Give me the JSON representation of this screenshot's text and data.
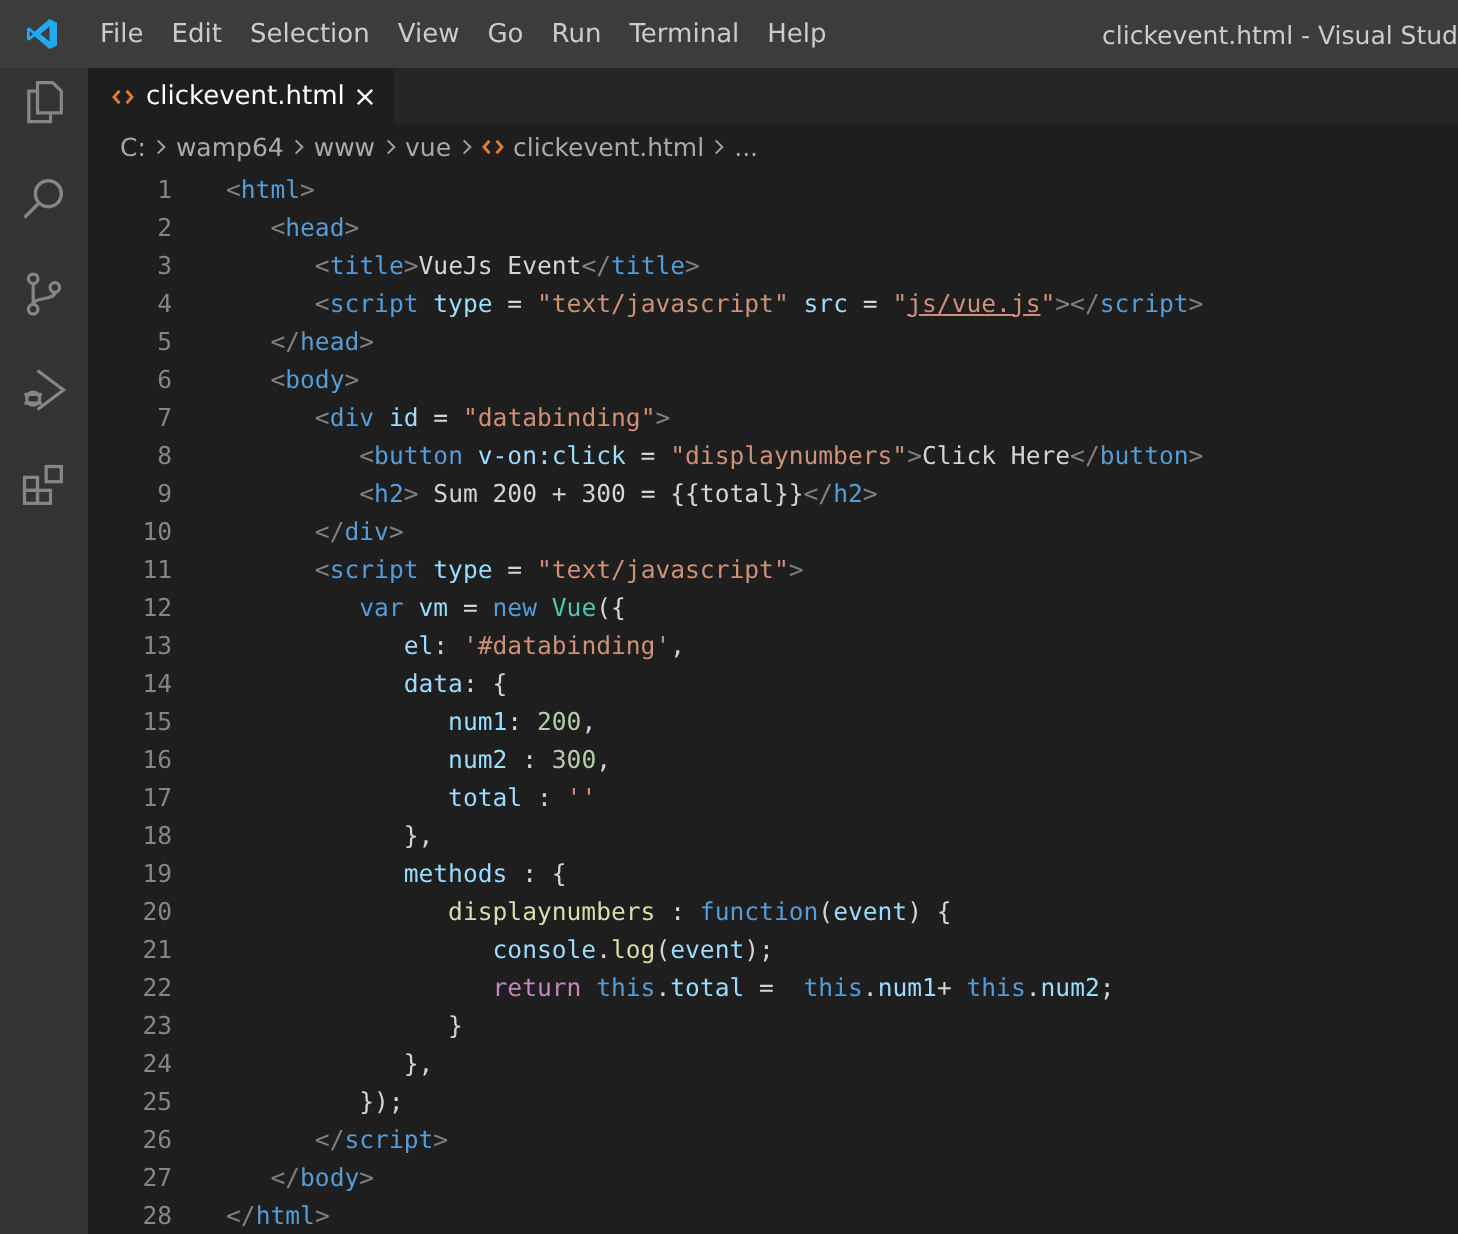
{
  "menu": [
    "File",
    "Edit",
    "Selection",
    "View",
    "Go",
    "Run",
    "Terminal",
    "Help"
  ],
  "window": {
    "title": "clickevent.html - Visual Stud"
  },
  "activity_bar": [
    {
      "kind": "files"
    },
    {
      "kind": "search"
    },
    {
      "kind": "source-control"
    },
    {
      "kind": "debug"
    },
    {
      "kind": "extensions"
    }
  ],
  "tabs": [
    {
      "label": "clickevent.html",
      "selected": true
    }
  ],
  "breadcrumbs": [
    {
      "kind": "folder",
      "text": "C:"
    },
    {
      "kind": "folder",
      "text": "wamp64"
    },
    {
      "kind": "folder",
      "text": "www"
    },
    {
      "kind": "folder",
      "text": "vue"
    },
    {
      "kind": "file",
      "text": "clickevent.html"
    },
    {
      "kind": "folder",
      "text": "..."
    }
  ],
  "lines": [
    {
      "number": "1",
      "tokens": [
        {
          "kind": "punct",
          "text": "<"
        },
        {
          "kind": "tag",
          "text": "html"
        },
        {
          "kind": "punct",
          "text": ">"
        }
      ]
    },
    {
      "number": "2",
      "tokens": [
        {
          "kind": "punct",
          "text": "   <"
        },
        {
          "kind": "tag",
          "text": "head"
        },
        {
          "kind": "punct",
          "text": ">"
        }
      ]
    },
    {
      "number": "3",
      "tokens": [
        {
          "kind": "punct",
          "text": "      <"
        },
        {
          "kind": "tag",
          "text": "title"
        },
        {
          "kind": "punct",
          "text": ">"
        },
        {
          "kind": "text",
          "text": "VueJs Event"
        },
        {
          "kind": "punct",
          "text": "</"
        },
        {
          "kind": "tag",
          "text": "title"
        },
        {
          "kind": "punct",
          "text": ">"
        }
      ]
    },
    {
      "number": "4",
      "tokens": [
        {
          "kind": "punct",
          "text": "      <"
        },
        {
          "kind": "tag",
          "text": "script"
        },
        {
          "kind": "attr",
          "text": " type"
        },
        {
          "kind": "text",
          "text": " = "
        },
        {
          "kind": "str",
          "text": "\"text/javascript\""
        },
        {
          "kind": "attr",
          "text": " src"
        },
        {
          "kind": "text",
          "text": " = "
        },
        {
          "kind": "str",
          "text": "\""
        },
        {
          "kind": "link",
          "text": "js/vue.js"
        },
        {
          "kind": "str",
          "text": "\""
        },
        {
          "kind": "punct",
          "text": "></"
        },
        {
          "kind": "tag",
          "text": "script"
        },
        {
          "kind": "punct",
          "text": ">"
        }
      ]
    },
    {
      "number": "5",
      "tokens": [
        {
          "kind": "punct",
          "text": "   </"
        },
        {
          "kind": "tag",
          "text": "head"
        },
        {
          "kind": "punct",
          "text": ">"
        }
      ]
    },
    {
      "number": "6",
      "tokens": [
        {
          "kind": "punct",
          "text": "   <"
        },
        {
          "kind": "tag",
          "text": "body"
        },
        {
          "kind": "punct",
          "text": ">"
        }
      ]
    },
    {
      "number": "7",
      "tokens": [
        {
          "kind": "punct",
          "text": "      <"
        },
        {
          "kind": "tag",
          "text": "div"
        },
        {
          "kind": "attr",
          "text": " id"
        },
        {
          "kind": "text",
          "text": " = "
        },
        {
          "kind": "str",
          "text": "\"databinding\""
        },
        {
          "kind": "punct",
          "text": ">"
        }
      ]
    },
    {
      "number": "8",
      "tokens": [
        {
          "kind": "punct",
          "text": "         <"
        },
        {
          "kind": "tag",
          "text": "button"
        },
        {
          "kind": "attr",
          "text": " v-on:click"
        },
        {
          "kind": "text",
          "text": " = "
        },
        {
          "kind": "str",
          "text": "\"displaynumbers\""
        },
        {
          "kind": "punct",
          "text": ">"
        },
        {
          "kind": "text",
          "text": "Click Here"
        },
        {
          "kind": "punct",
          "text": "</"
        },
        {
          "kind": "tag",
          "text": "button"
        },
        {
          "kind": "punct",
          "text": ">"
        }
      ]
    },
    {
      "number": "9",
      "tokens": [
        {
          "kind": "punct",
          "text": "         <"
        },
        {
          "kind": "tag",
          "text": "h2"
        },
        {
          "kind": "punct",
          "text": ">"
        },
        {
          "kind": "text",
          "text": " Sum 200 + 300 = {{total}}"
        },
        {
          "kind": "punct",
          "text": "</"
        },
        {
          "kind": "tag",
          "text": "h2"
        },
        {
          "kind": "punct",
          "text": ">"
        }
      ]
    },
    {
      "number": "10",
      "tokens": [
        {
          "kind": "punct",
          "text": "      </"
        },
        {
          "kind": "tag",
          "text": "div"
        },
        {
          "kind": "punct",
          "text": ">"
        }
      ]
    },
    {
      "number": "11",
      "tokens": [
        {
          "kind": "punct",
          "text": "      <"
        },
        {
          "kind": "tag",
          "text": "script"
        },
        {
          "kind": "attr",
          "text": " type"
        },
        {
          "kind": "text",
          "text": " = "
        },
        {
          "kind": "str",
          "text": "\"text/javascript\""
        },
        {
          "kind": "punct",
          "text": ">"
        }
      ]
    },
    {
      "number": "12",
      "tokens": [
        {
          "kind": "kw",
          "text": "         var"
        },
        {
          "kind": "var",
          "text": " vm"
        },
        {
          "kind": "text",
          "text": " = "
        },
        {
          "kind": "kw",
          "text": "new"
        },
        {
          "kind": "cls",
          "text": " Vue"
        },
        {
          "kind": "text",
          "text": "({"
        }
      ]
    },
    {
      "number": "13",
      "tokens": [
        {
          "kind": "var",
          "text": "            el"
        },
        {
          "kind": "text",
          "text": ": "
        },
        {
          "kind": "str",
          "text": "'#databinding'"
        },
        {
          "kind": "text",
          "text": ","
        }
      ]
    },
    {
      "number": "14",
      "tokens": [
        {
          "kind": "var",
          "text": "            data"
        },
        {
          "kind": "text",
          "text": ": {"
        }
      ]
    },
    {
      "number": "15",
      "tokens": [
        {
          "kind": "var",
          "text": "               num1"
        },
        {
          "kind": "text",
          "text": ": "
        },
        {
          "kind": "num",
          "text": "200"
        },
        {
          "kind": "text",
          "text": ","
        }
      ]
    },
    {
      "number": "16",
      "tokens": [
        {
          "kind": "var",
          "text": "               num2"
        },
        {
          "kind": "text",
          "text": " : "
        },
        {
          "kind": "num",
          "text": "300"
        },
        {
          "kind": "text",
          "text": ","
        }
      ]
    },
    {
      "number": "17",
      "tokens": [
        {
          "kind": "var",
          "text": "               total"
        },
        {
          "kind": "text",
          "text": " : "
        },
        {
          "kind": "str",
          "text": "''"
        }
      ]
    },
    {
      "number": "18",
      "tokens": [
        {
          "kind": "text",
          "text": "            },"
        }
      ]
    },
    {
      "number": "19",
      "tokens": [
        {
          "kind": "var",
          "text": "            methods"
        },
        {
          "kind": "text",
          "text": " : {"
        }
      ]
    },
    {
      "number": "20",
      "tokens": [
        {
          "kind": "fn",
          "text": "               displaynumbers"
        },
        {
          "kind": "text",
          "text": " : "
        },
        {
          "kind": "kw",
          "text": "function"
        },
        {
          "kind": "text",
          "text": "("
        },
        {
          "kind": "var",
          "text": "event"
        },
        {
          "kind": "text",
          "text": ") {"
        }
      ]
    },
    {
      "number": "21",
      "tokens": [
        {
          "kind": "var",
          "text": "                  console"
        },
        {
          "kind": "text",
          "text": "."
        },
        {
          "kind": "fn",
          "text": "log"
        },
        {
          "kind": "text",
          "text": "("
        },
        {
          "kind": "var",
          "text": "event"
        },
        {
          "kind": "text",
          "text": ");"
        }
      ]
    },
    {
      "number": "22",
      "tokens": [
        {
          "kind": "ctl",
          "text": "                  return"
        },
        {
          "kind": "kw",
          "text": " this"
        },
        {
          "kind": "text",
          "text": "."
        },
        {
          "kind": "var",
          "text": "total"
        },
        {
          "kind": "text",
          "text": " =  "
        },
        {
          "kind": "kw",
          "text": "this"
        },
        {
          "kind": "text",
          "text": "."
        },
        {
          "kind": "var",
          "text": "num1"
        },
        {
          "kind": "text",
          "text": "+ "
        },
        {
          "kind": "kw",
          "text": "this"
        },
        {
          "kind": "text",
          "text": "."
        },
        {
          "kind": "var",
          "text": "num2"
        },
        {
          "kind": "text",
          "text": ";"
        }
      ]
    },
    {
      "number": "23",
      "tokens": [
        {
          "kind": "text",
          "text": "               }"
        }
      ]
    },
    {
      "number": "24",
      "tokens": [
        {
          "kind": "text",
          "text": "            },"
        }
      ]
    },
    {
      "number": "25",
      "tokens": [
        {
          "kind": "text",
          "text": "         });"
        }
      ]
    },
    {
      "number": "26",
      "tokens": [
        {
          "kind": "punct",
          "text": "      </"
        },
        {
          "kind": "tag",
          "text": "script"
        },
        {
          "kind": "punct",
          "text": ">"
        }
      ]
    },
    {
      "number": "27",
      "tokens": [
        {
          "kind": "punct",
          "text": "   </"
        },
        {
          "kind": "tag",
          "text": "body"
        },
        {
          "kind": "punct",
          "text": ">"
        }
      ]
    },
    {
      "number": "28",
      "tokens": [
        {
          "kind": "punct",
          "text": "</"
        },
        {
          "kind": "tag",
          "text": "html"
        },
        {
          "kind": "punct",
          "text": ">"
        }
      ]
    }
  ]
}
